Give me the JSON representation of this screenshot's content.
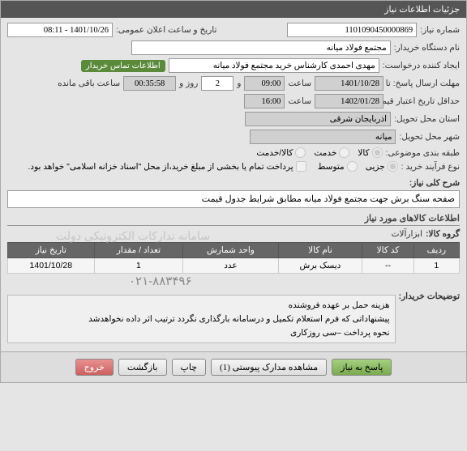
{
  "header": "جزئیات اطلاعات نیاز",
  "fields": {
    "need_no_label": "شماره نیاز:",
    "need_no": "1101090450000869",
    "announce_label": "تاریخ و ساعت اعلان عمومی:",
    "announce": "1401/10/26 - 08:11",
    "buyer_org_label": "نام دستگاه خریدار:",
    "buyer_org": "مجتمع فولاد میانه",
    "creator_label": "ایجاد کننده درخواست:",
    "creator": "مهدی احمدی کارشناس خرید مجتمع فولاد میانه",
    "contact_link": "اطلاعات تماس خریدار",
    "deadline_label": "مهلت ارسال پاسخ: تا تاریخ:",
    "deadline_date": "1401/10/28",
    "at_label": "ساعت",
    "deadline_time": "09:00",
    "and_label": "و",
    "days_left": "2",
    "days_and": "روز و",
    "countdown": "00:35:58",
    "remain_label": "ساعت باقی مانده",
    "validity_label": "حداقل تاریخ اعتبار قیمت: تا تاریخ:",
    "validity_date": "1402/01/28",
    "validity_time": "16:00",
    "province_label": "استان محل تحویل:",
    "province": "آذربایجان شرقی",
    "city_label": "شهر محل تحویل:",
    "city": "میانه",
    "class_label": "طبقه بندی موضوعی:",
    "class_goods": "کالا",
    "class_service": "خدمت",
    "class_goods_service": "کالا/خدمت",
    "purchase_type_label": "نوع فرآیند خرید :",
    "pt_minor": "جزیی",
    "pt_medium": "متوسط",
    "pt_note": "پرداخت تمام یا بخشی از مبلغ خرید،از محل \"اسناد خزانه اسلامی\" خواهد بود.",
    "desc_label": "شرح کلی نیاز:",
    "desc_value": "صفحه سنگ برش  جهت مجتمع فولاد میانه مطابق شرایط جدول قیمت",
    "items_section": "اطلاعات کالاهای مورد نیاز",
    "group_label": "گروه کالا:",
    "group_value": "ابزارآلات",
    "watermark": "سامانه تدارکات الکترونیکی دولت",
    "buyer_notes_label": "توضیحات خریدار:",
    "buyer_notes": "هزینه حمل بر عهده فروشنده\nپیشنهاداتی که فرم استعلام تکمیل و درسامانه بارگذاری نگردد ترتیب اثر داده نخواهدشد\nنحوه پرداخت –سی روزکاری",
    "cut_number": "۰۲۱-۸۸۳۴۹۶"
  },
  "table": {
    "headers": [
      "ردیف",
      "کد کالا",
      "نام کالا",
      "واحد شمارش",
      "تعداد / مقدار",
      "تاریخ نیاز"
    ],
    "rows": [
      [
        "1",
        "--",
        "دیسک برش",
        "عدد",
        "1",
        "1401/10/28"
      ]
    ]
  },
  "buttons": {
    "reply": "پاسخ به نیاز",
    "attachments": "مشاهده مدارک پیوستی (1)",
    "print": "چاپ",
    "back": "بازگشت",
    "exit": "خروج"
  }
}
